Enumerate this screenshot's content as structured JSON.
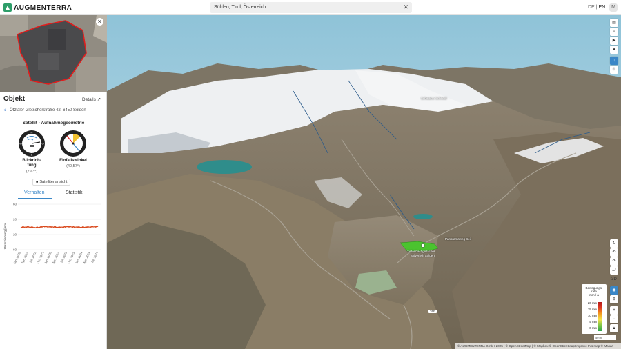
{
  "header": {
    "logo_text": "AUGMENTERRA",
    "search_value": "Sölden, Tirol, Österreich",
    "lang_de": "DE",
    "lang_sep": " | ",
    "lang_en": "EN",
    "user_initial": "M"
  },
  "sidebar": {
    "title": "Objekt",
    "details_label": "Details",
    "address": "Ötztaler Gletscherstraße 42, 6450 Sölden",
    "satellite_title": "Satellit - Aufnahmegeometrie",
    "viewing_label": "Blickrich-\ntung",
    "viewing_value": "(79,3°)",
    "incidence_label": "Einfallswinkel",
    "incidence_value": "(40,57°)",
    "sat_view_button": "Satellitenansicht",
    "tab_behavior": "Verhalten",
    "tab_stats": "Statistik",
    "compass": {
      "n": "N",
      "o": "O",
      "s": "S",
      "w": "W"
    }
  },
  "chart_data": {
    "type": "line",
    "ylabel": "Verschiebung [mm]",
    "ylim": [
      -60,
      60
    ],
    "yticks": [
      "60",
      "20",
      "-20",
      "-60"
    ],
    "categories": [
      "Jan. 2022",
      "Apr. 2022",
      "Jul. 2022",
      "Okt. 2022",
      "Jan. 2023",
      "Apr. 2023",
      "Jul. 2023",
      "Okt. 2023",
      "Jan. 2024",
      "Apr. 2024",
      "Jul. 2024"
    ],
    "series": [
      {
        "values": [
          -1,
          0,
          -2,
          1,
          0,
          -1,
          1,
          0,
          -1,
          0,
          1
        ],
        "color": "#d9481c"
      }
    ]
  },
  "map": {
    "labels": [
      "Tiefenbachgletscher",
      "Skiverleih Sölden",
      "Panoramaweg Seil",
      "Schwarze Schneid"
    ],
    "road_label": "26b",
    "legend_title": "Bewegungs-\nrate\nmm / a",
    "legend_ticks": [
      "20 mm",
      "15 mm",
      "10 mm",
      "5 mm",
      "0 mm"
    ],
    "scale_label": "50 m",
    "attribution": "© AUGMENTERRA GmbH 2025 | © OpenStreetMap | © Mapbox © OpenStreetMap  Improve this map © Maxar",
    "colors": {
      "accent": "#3a87c7",
      "brand": "#2e9e6a"
    }
  },
  "toolbar": {
    "icons": [
      "layers-icon",
      "list-icon",
      "video-icon",
      "person-icon",
      "pin-icon",
      "settings-icon"
    ],
    "nav_icons": [
      "rotate-icon",
      "undo-icon",
      "redo-icon",
      "tilt-icon"
    ],
    "nav_3d": "3D",
    "zoom_in": "+",
    "zoom_out": "−"
  }
}
